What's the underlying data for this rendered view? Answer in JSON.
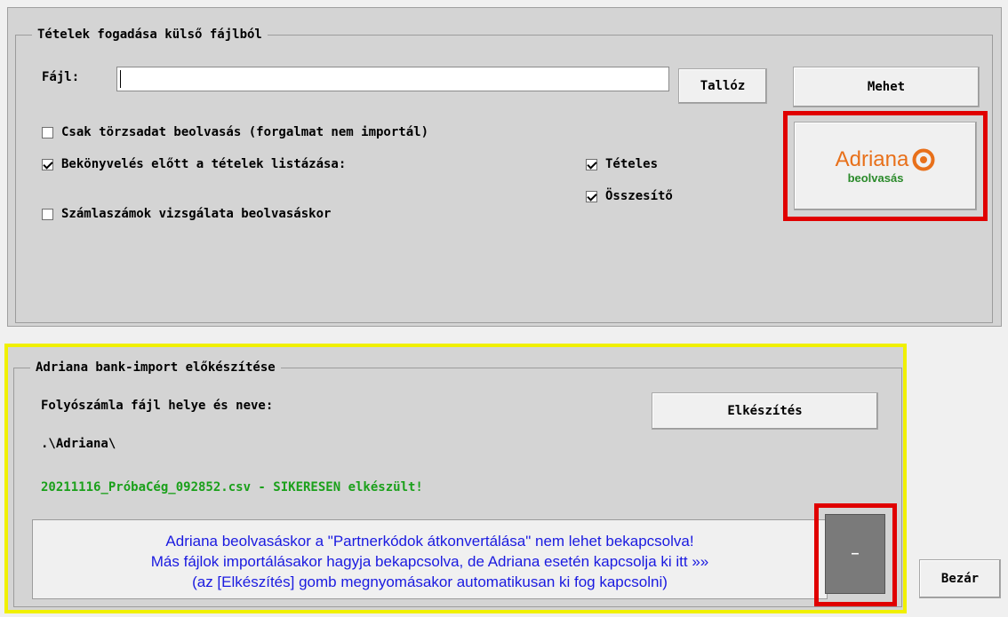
{
  "import_section": {
    "title": "Tételek fogadása külső fájlból",
    "file_label": "Fájl:",
    "file_value": "",
    "browse_button": "Tallóz",
    "go_button": "Mehet",
    "options": [
      {
        "label": "Csak törzsadat beolvasás (forgalmat nem importál)",
        "checked": false
      },
      {
        "label": "Bekönyvelés előtt a tételek listázása:",
        "checked": true
      },
      {
        "label": "Számlaszámok vizsgálata beolvasáskor",
        "checked": false
      }
    ],
    "list_options": [
      {
        "label": "Tételes",
        "checked": true
      },
      {
        "label": "Összesítő",
        "checked": true
      }
    ],
    "adriana_button": {
      "brand": "Adriana",
      "sub": "beolvasás",
      "brand_color": "#e8701a",
      "sub_color": "#2a8a2a"
    }
  },
  "bank_section": {
    "title": "Adriana bank-import előkészítése",
    "path_label": "Folyószámla fájl helye és neve:",
    "path_value": ".\\Adriana\\",
    "result": "20211116_PróbaCég_092852.csv - SIKERESEN elkészült!",
    "prepare_button": "Elkészítés",
    "notice_lines": [
      "Adriana beolvasáskor a \"Partnerkódok átkonvertálása\" nem lehet bekapcsolva!",
      "Más fájlok importálásakor hagyja bekapcsolva, de Adriana esetén kapcsolja ki itt  »»",
      "(az [Elkészítés] gomb megnyomásakor automatikusan ki fog kapcsolni)"
    ],
    "toggle_symbol": "–"
  },
  "close_button": "Bezár",
  "colors": {
    "highlight_red": "#e00000",
    "highlight_yellow": "#f0f000",
    "notice_blue": "#1a1ae0",
    "success_green": "#1aa01a"
  }
}
